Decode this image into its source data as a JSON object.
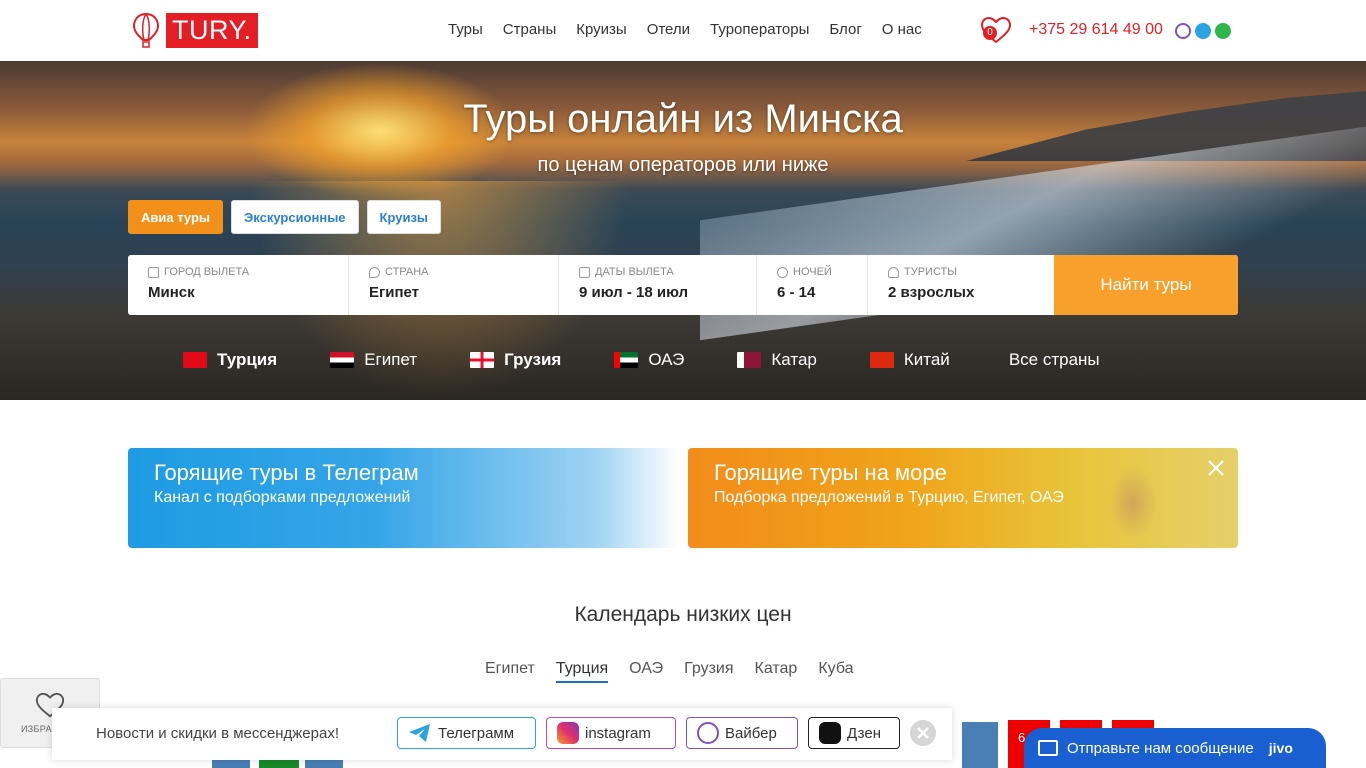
{
  "header": {
    "logo_text": "TURY.",
    "nav": [
      "Туры",
      "Страны",
      "Круизы",
      "Отели",
      "Туроператоры",
      "Блог",
      "О нас"
    ],
    "favorites_count": "0",
    "phone": "+375 29 614 49 00",
    "messenger_icons": [
      "viber-icon",
      "telegram-icon",
      "whatsapp-icon"
    ]
  },
  "hero": {
    "title": "Туры онлайн из Минска",
    "subtitle": "по ценам операторов или ниже",
    "tabs": [
      {
        "label": "Авиа туры",
        "active": true
      },
      {
        "label": "Экскурсионные",
        "active": false
      },
      {
        "label": "Круизы",
        "active": false
      }
    ],
    "search": {
      "fields": [
        {
          "label": "ГОРОД ВЫЛЕТА",
          "value": "Минск",
          "icon": "plane-icon"
        },
        {
          "label": "СТРАНА",
          "value": "Египет",
          "icon": "location-icon"
        },
        {
          "label": "ДАТЫ ВЫЛЕТА",
          "value": "9 июл - 18 июл",
          "icon": "calendar-icon"
        },
        {
          "label": "НОЧЕЙ",
          "value": "6 - 14",
          "icon": "clock-icon"
        },
        {
          "label": "ТУРИСТЫ",
          "value": "2 взрослых",
          "icon": "person-icon"
        }
      ],
      "button": "Найти туры"
    },
    "countries": [
      {
        "name": "Турция",
        "bold": true
      },
      {
        "name": "Египет",
        "bold": false
      },
      {
        "name": "Грузия",
        "bold": true
      },
      {
        "name": "ОАЭ",
        "bold": false
      },
      {
        "name": "Катар",
        "bold": false
      },
      {
        "name": "Китай",
        "bold": false
      }
    ],
    "all_countries": "Все страны"
  },
  "banners": {
    "telegram": {
      "title": "Горящие туры в Телеграм",
      "subtitle": "Канал с подборками предложений"
    },
    "sea": {
      "title": "Горящие туры на море",
      "subtitle": "Подборка предложений в Турцию, Египет, ОАЭ"
    }
  },
  "calendar": {
    "title": "Календарь низких цен",
    "tabs": [
      {
        "label": "Египет",
        "active": false
      },
      {
        "label": "Турция",
        "active": true
      },
      {
        "label": "ОАЭ",
        "active": false
      },
      {
        "label": "Грузия",
        "active": false
      },
      {
        "label": "Катар",
        "active": false
      },
      {
        "label": "Куба",
        "active": false
      }
    ],
    "visible_bar_label": "6"
  },
  "favorites_box": {
    "label": "ИЗБРАННОЕ"
  },
  "messenger_bar": {
    "text": "Новости и скидки в мессенджерах!",
    "buttons": [
      "Телеграмм",
      "instagram",
      "Вайбер",
      "Дзен"
    ]
  },
  "jivo": {
    "text": "Отправьте нам сообщение",
    "brand": "jivo"
  },
  "colors": {
    "brand_red": "#e31e24",
    "orange": "#f39019",
    "blue": "#2a7fd2",
    "jivo_blue": "#1a5fd0"
  }
}
